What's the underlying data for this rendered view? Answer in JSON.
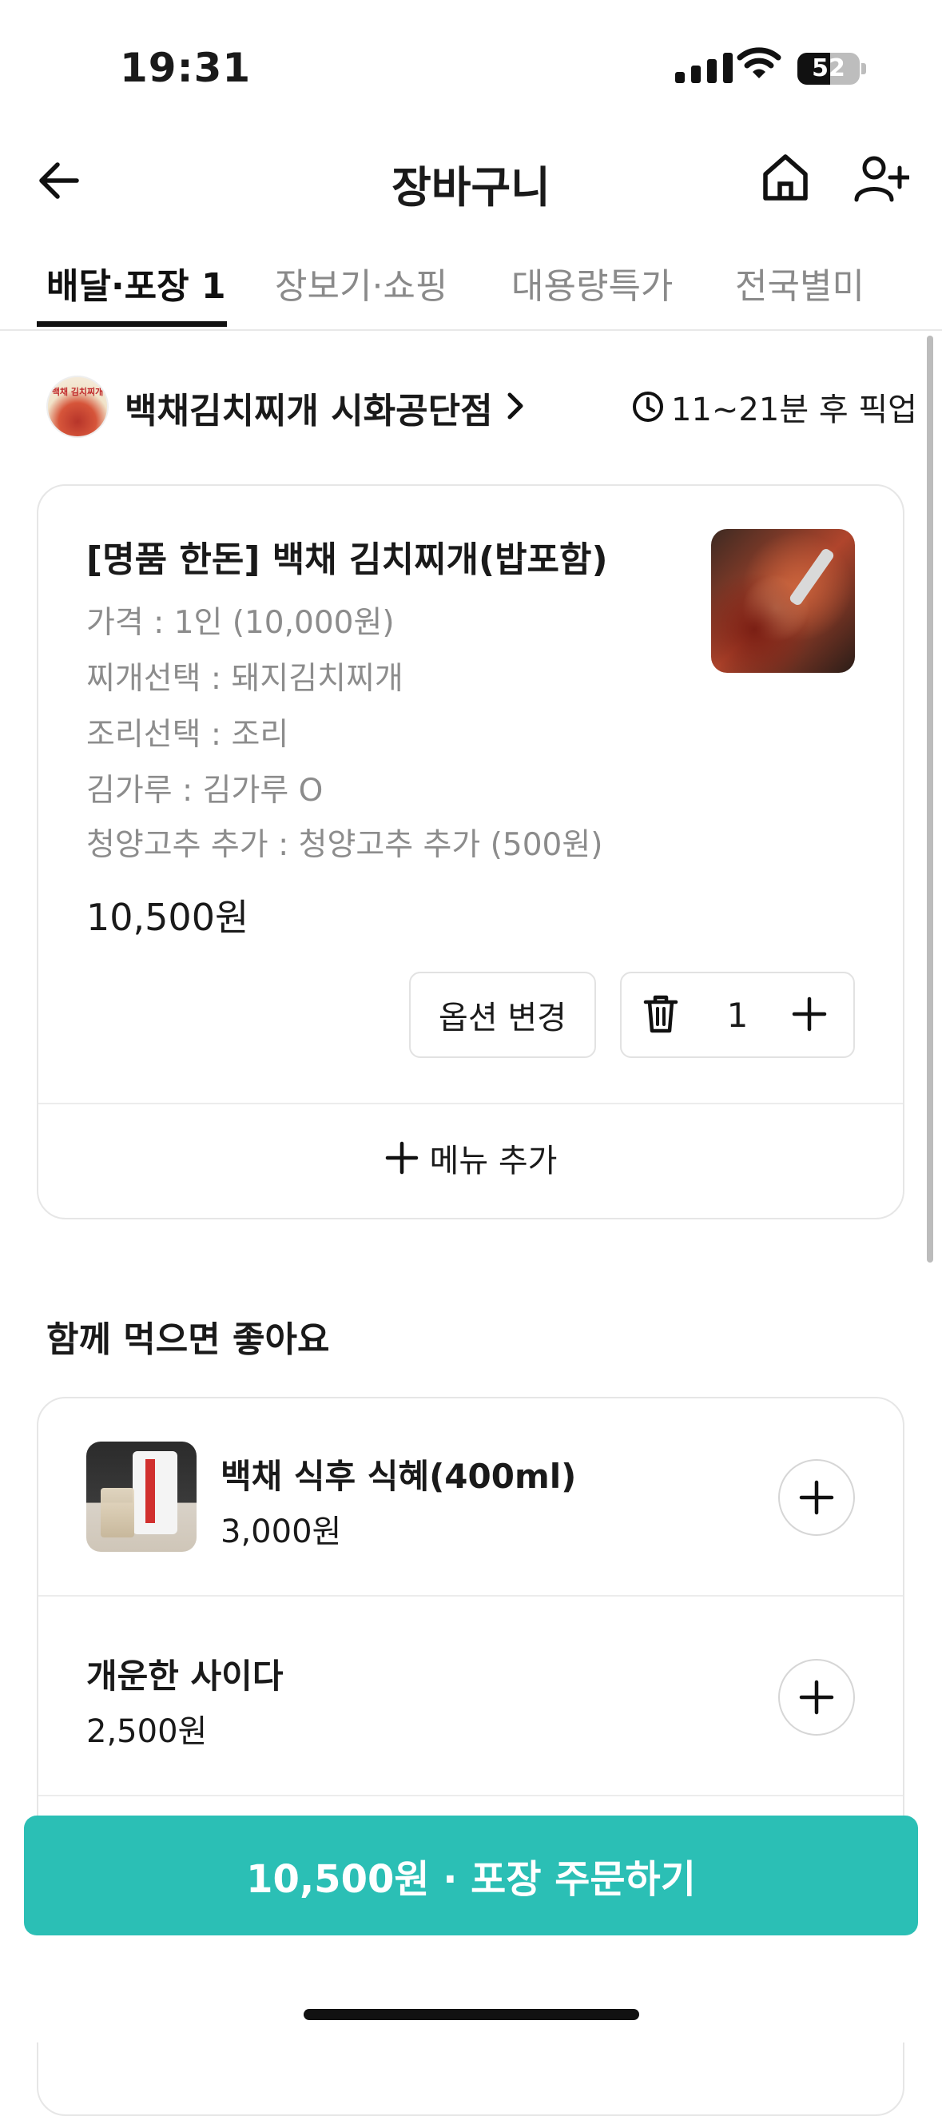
{
  "status_bar": {
    "time": "19:31",
    "battery": "52",
    "battery_fraction": 0.52
  },
  "header": {
    "title": "장바구니",
    "icons": [
      "back-arrow-icon",
      "home-icon",
      "add-user-icon"
    ]
  },
  "tabs": [
    {
      "label": "배달·포장 1",
      "active": true
    },
    {
      "label": "장보기·쇼핑",
      "active": false
    },
    {
      "label": "대용량특가",
      "active": false
    },
    {
      "label": "전국별미",
      "active": false
    }
  ],
  "store": {
    "logo_text": "백채 김치찌개",
    "name": "백채김치찌개 시화공단점",
    "pickup_time": "11~21분 후 픽업"
  },
  "cart_item": {
    "name": "[명품 한돈] 백채 김치찌개(밥포함)",
    "options": [
      "가격 : 1인 (10,000원)",
      "찌개선택 : 돼지김치찌개",
      "조리선택 : 조리",
      "김가루 : 김가루 O",
      "청양고추 추가 : 청양고추 추가 (500원)"
    ],
    "price": "10,500원",
    "option_change_label": "옵션 변경",
    "quantity": "1"
  },
  "add_menu_label": "메뉴 추가",
  "recommend": {
    "title": "함께 먹으면 좋아요",
    "items": [
      {
        "name": "백채 식후 식혜(400ml)",
        "price": "3,000원"
      },
      {
        "name": "개운한 사이다",
        "price": "2,500원"
      }
    ]
  },
  "order_button": {
    "label": "10,500원 · 포장 주문하기"
  },
  "colors": {
    "accent": "#2bbfb5",
    "text": "#1a1a1a",
    "muted": "#8c8c8c",
    "border": "#e6e6e6"
  }
}
